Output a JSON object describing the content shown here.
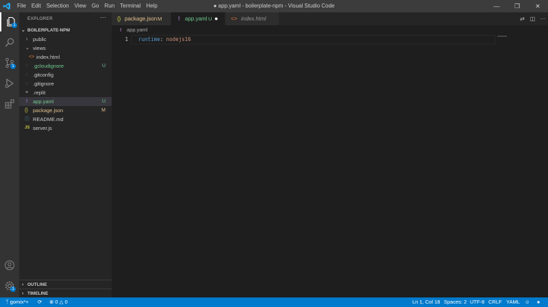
{
  "titlebar": {
    "menu": [
      "File",
      "Edit",
      "Selection",
      "View",
      "Go",
      "Run",
      "Terminal",
      "Help"
    ],
    "title": "● app.yaml - boilerplate-npm - Visual Studio Code"
  },
  "activity": {
    "explorer_badge": "1",
    "settings_badge": "1"
  },
  "sidebar": {
    "header": "EXPLORER",
    "more": "···",
    "project": "BOILERPLATE-NPM",
    "tree": [
      {
        "label": "public",
        "type": "folder",
        "open": false
      },
      {
        "label": "views",
        "type": "folder",
        "open": true
      },
      {
        "label": "index.html",
        "type": "html"
      },
      {
        "label": ".gcloudignore",
        "type": "dot",
        "status": "U"
      },
      {
        "label": ".gitconfig",
        "type": "dot"
      },
      {
        "label": ".gitignore",
        "type": "dot"
      },
      {
        "label": ".replit",
        "type": "plain"
      },
      {
        "label": "app.yaml",
        "type": "yaml",
        "status": "U"
      },
      {
        "label": "package.json",
        "type": "json",
        "status": "M"
      },
      {
        "label": "README.md",
        "type": "info"
      },
      {
        "label": "server.js",
        "type": "js"
      }
    ],
    "outline": "OUTLINE",
    "timeline": "TIMELINE"
  },
  "tabs": [
    {
      "icon": "{}",
      "label": "package.json",
      "marker": "M"
    },
    {
      "icon": "!",
      "label": "app.yaml",
      "marker": "U"
    },
    {
      "icon": "<>",
      "label": "index.html",
      "marker": ""
    }
  ],
  "breadcrumb": {
    "icon": "!",
    "label": "app.yaml"
  },
  "editor": {
    "line_numbers": [
      "1"
    ],
    "line1": {
      "key": "runtime",
      "sep": ": ",
      "value": "nodejs16"
    }
  },
  "status": {
    "branch": "gomix*+",
    "problems": "0",
    "warnings": "0",
    "position": "Ln 1, Col 18",
    "spaces": "Spaces: 2",
    "encoding": "UTF-8",
    "eol": "CRLF",
    "language": "YAML"
  },
  "colors": {
    "accent": "#007acc",
    "titlebar": "#3c3c3c",
    "activitybar": "#333333",
    "sidebar": "#252526",
    "editor": "#1e1e1e",
    "git_untracked": "#73c991",
    "git_modified": "#e2c08d",
    "yaml_key": "#569cd6",
    "yaml_value": "#ce9178"
  }
}
